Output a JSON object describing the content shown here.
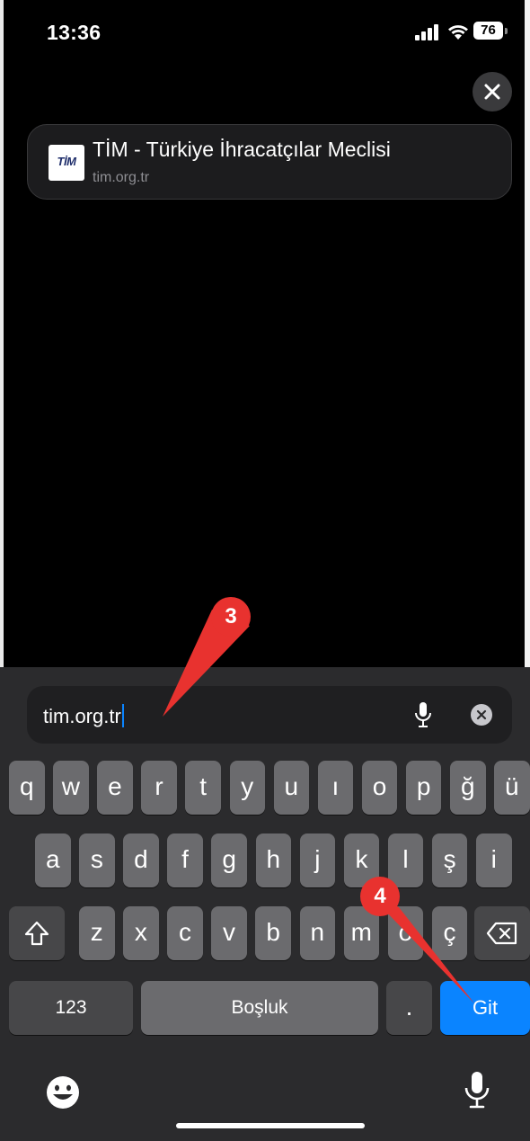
{
  "status": {
    "time": "13:36",
    "battery": "76"
  },
  "suggestion": {
    "favicon_text": "TİM",
    "title": "TİM - Türkiye İhracatçılar Meclisi",
    "url": "tim.org.tr"
  },
  "address_bar": {
    "value": "tim.org.tr"
  },
  "keyboard": {
    "row1": [
      "q",
      "w",
      "e",
      "r",
      "t",
      "y",
      "u",
      "ı",
      "o",
      "p",
      "ğ",
      "ü"
    ],
    "row2": [
      "a",
      "s",
      "d",
      "f",
      "g",
      "h",
      "j",
      "k",
      "l",
      "ş",
      "i"
    ],
    "row3": [
      "z",
      "x",
      "c",
      "v",
      "b",
      "n",
      "m",
      "ö",
      "ç"
    ],
    "numbers_label": "123",
    "space_label": "Boşluk",
    "period_label": ".",
    "go_label": "Git"
  },
  "annotations": {
    "step_a": "3",
    "step_b": "4"
  },
  "colors": {
    "accent": "#0a84ff",
    "annotation": "#e8322f"
  }
}
